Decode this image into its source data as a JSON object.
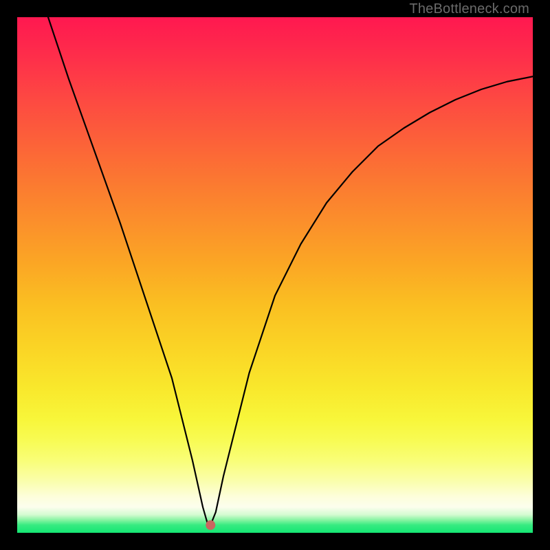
{
  "watermark": "TheBottleneck.com",
  "chart_data": {
    "type": "line",
    "title": "",
    "xlabel": "",
    "ylabel": "",
    "xlim": [
      0,
      100
    ],
    "ylim": [
      0,
      100
    ],
    "series": [
      {
        "name": "curve",
        "x": [
          6,
          10,
          15,
          20,
          25,
          30,
          32,
          34,
          36,
          37,
          37.5,
          38.5,
          40,
          45,
          50,
          55,
          60,
          65,
          70,
          75,
          80,
          85,
          90,
          95,
          100
        ],
        "y": [
          100,
          88,
          74,
          60,
          45,
          30,
          22,
          14,
          5,
          1.5,
          1.5,
          4,
          11,
          31,
          46,
          56,
          64,
          70,
          75,
          78.5,
          81.5,
          84,
          86,
          87.5,
          88.5
        ]
      }
    ],
    "marker": {
      "x": 37.5,
      "y": 1.5,
      "color": "#c96660",
      "radius": 7
    },
    "gradient_stops": [
      {
        "pos": 0,
        "color": "#ff1850"
      },
      {
        "pos": 8,
        "color": "#fe2f4a"
      },
      {
        "pos": 16,
        "color": "#fd4942"
      },
      {
        "pos": 24,
        "color": "#fc6139"
      },
      {
        "pos": 32,
        "color": "#fb7931"
      },
      {
        "pos": 40,
        "color": "#fb902b"
      },
      {
        "pos": 48,
        "color": "#fba724"
      },
      {
        "pos": 56,
        "color": "#fac022"
      },
      {
        "pos": 64,
        "color": "#fad425"
      },
      {
        "pos": 72,
        "color": "#f9e82c"
      },
      {
        "pos": 78,
        "color": "#f8f63a"
      },
      {
        "pos": 82,
        "color": "#f8fb53"
      },
      {
        "pos": 86,
        "color": "#f9fe78"
      },
      {
        "pos": 90,
        "color": "#fafeac"
      },
      {
        "pos": 93,
        "color": "#fdfedb"
      },
      {
        "pos": 95,
        "color": "#fcfeed"
      },
      {
        "pos": 96.5,
        "color": "#d3fbd1"
      },
      {
        "pos": 97.5,
        "color": "#89f4a3"
      },
      {
        "pos": 98.5,
        "color": "#36eb81"
      },
      {
        "pos": 100,
        "color": "#14e673"
      }
    ]
  }
}
